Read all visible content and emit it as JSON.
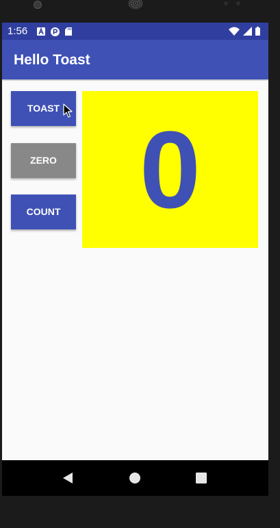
{
  "status_bar": {
    "time": "1:56",
    "notification_icons": [
      "a-letter-icon",
      "p-badge-icon",
      "sd-card-icon"
    ],
    "system_icons": [
      "wifi-icon",
      "signal-icon",
      "battery-icon"
    ]
  },
  "app_bar": {
    "title": "Hello Toast"
  },
  "buttons": {
    "toast_label": "TOAST",
    "zero_label": "ZERO",
    "count_label": "COUNT"
  },
  "counter": {
    "value": "0"
  },
  "colors": {
    "primary": "#3f51b5",
    "primary_dark": "#303f9f",
    "zero_button": "#888888",
    "count_background": "#ffff00",
    "count_text": "#3f51b5"
  },
  "nav_bar": {
    "icons": [
      "back-icon",
      "home-icon",
      "recents-icon"
    ]
  }
}
